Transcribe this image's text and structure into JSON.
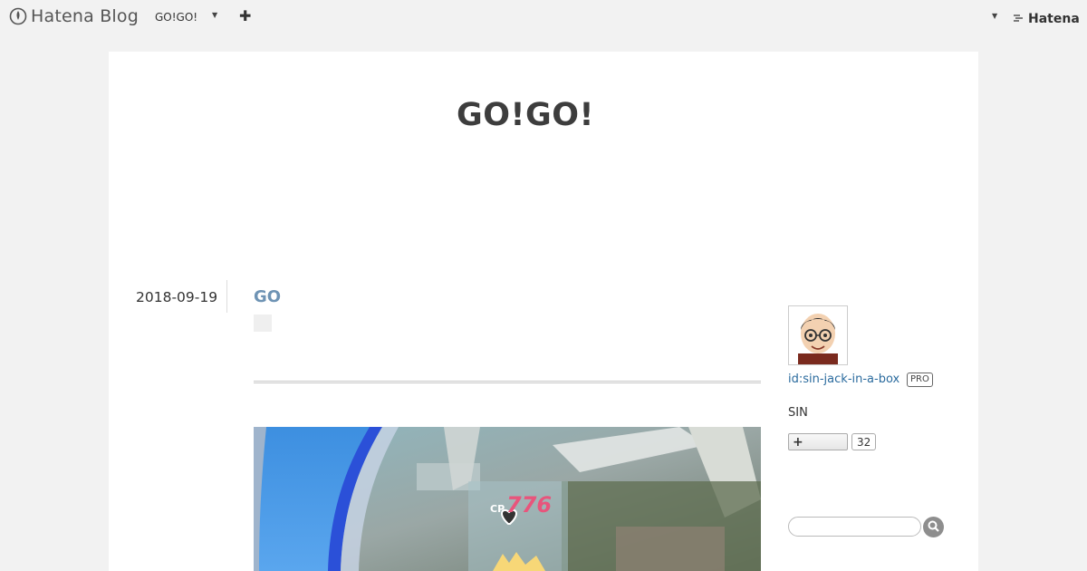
{
  "topbar": {
    "brand": "Hatena Blog",
    "blog_name": "GO!GO!",
    "right_brand": "Hatena",
    "icons": [
      "hatena-blog-logo-icon",
      "caret-down-icon",
      "plus-icon",
      "hatena-logo-icon",
      "search-icon"
    ]
  },
  "blog": {
    "title": "GO!GO!"
  },
  "entry": {
    "date": "2018-09-19",
    "title": "GO",
    "photo": {
      "cp_label": "CP",
      "cp_value": "776"
    }
  },
  "sidebar": {
    "profile_id": "id:sin-jack-in-a-box",
    "pro_badge": "PRO",
    "name": "SIN",
    "follow_label": "+",
    "follow_count": "32",
    "search_placeholder": ""
  },
  "colors": {
    "background": "#f2f2f2",
    "card": "#ffffff",
    "entry_title": "#6e93b4",
    "link": "#2b6b9e",
    "cp_value": "#e8557c"
  }
}
